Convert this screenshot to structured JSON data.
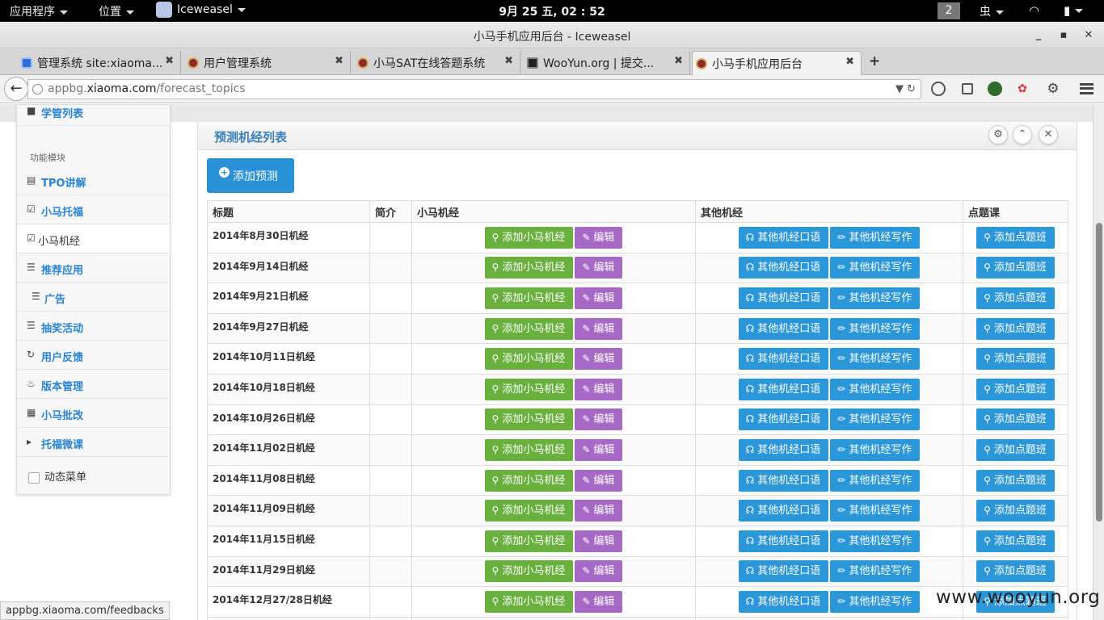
{
  "topbar": {
    "apps": "应用程序",
    "places": "位置",
    "browser": "Iceweasel",
    "clock": "9月 25 五, 02 : 52",
    "workspace": "2",
    "input_method": "虫"
  },
  "window": {
    "title": "小马手机应用后台 - Iceweasel",
    "min": "_",
    "max": "▪",
    "close": "✕"
  },
  "tabs": [
    {
      "label": "管理系统 site:xiaoma...",
      "close": "✖"
    },
    {
      "label": "用户管理系统",
      "close": "✖"
    },
    {
      "label": "小马SAT在线答题系统",
      "close": "✖"
    },
    {
      "label": "WooYun.org | 提交...",
      "close": "✖"
    },
    {
      "label": "小马手机应用后台",
      "close": "✖"
    }
  ],
  "newtab": "+",
  "url": {
    "prefix": "appbg.",
    "host": "xiaoma.com",
    "path": "/forecast_topics",
    "controls": "▼ ↻"
  },
  "sidebar": {
    "top_item": "学管列表",
    "section_head": "功能模块",
    "items": [
      {
        "label": "TPO讲解",
        "icon": "list-icon"
      },
      {
        "label": "小马托福",
        "icon": "edit-icon"
      },
      {
        "label": "小马机经",
        "icon": "edit-icon"
      },
      {
        "label": "推荐应用",
        "icon": "list-icon"
      },
      {
        "label": "广告",
        "icon": "list-icon"
      },
      {
        "label": "抽奖活动",
        "icon": "list-icon"
      },
      {
        "label": "用户反馈",
        "icon": "refresh-icon"
      },
      {
        "label": "版本管理",
        "icon": "fire-icon"
      },
      {
        "label": "小马批改",
        "icon": "fullscreen-icon"
      },
      {
        "label": "托福微课",
        "icon": "bullhorn-icon"
      }
    ],
    "dynamic_menu": "动态菜单"
  },
  "widget": {
    "title": "预测机经列表",
    "add_button": "添加预测"
  },
  "table": {
    "headers": [
      "标题",
      "简介",
      "小马机经",
      "其他机经",
      "点题课"
    ],
    "buttons": {
      "add_xiaoma": "添加小马机经",
      "edit": "编辑",
      "other_speaking": "其他机经口语",
      "other_writing": "其他机经写作",
      "add_class": "添加点题班"
    },
    "rows": [
      "2014年8月30日机经",
      "2014年9月14日机经",
      "2014年9月21日机经",
      "2014年9月27日机经",
      "2014年10月11日机经",
      "2014年10月18日机经",
      "2014年10月26日机经",
      "2014年11月02日机经",
      "2014年11月08日机经",
      "2014年11月09日机经",
      "2014年11月15日机经",
      "2014年11月29日机经",
      "2014年12月27/28日机经",
      ""
    ]
  },
  "status_url": "appbg.xiaoma.com/feedbacks",
  "watermark": "www.wooyun.org"
}
